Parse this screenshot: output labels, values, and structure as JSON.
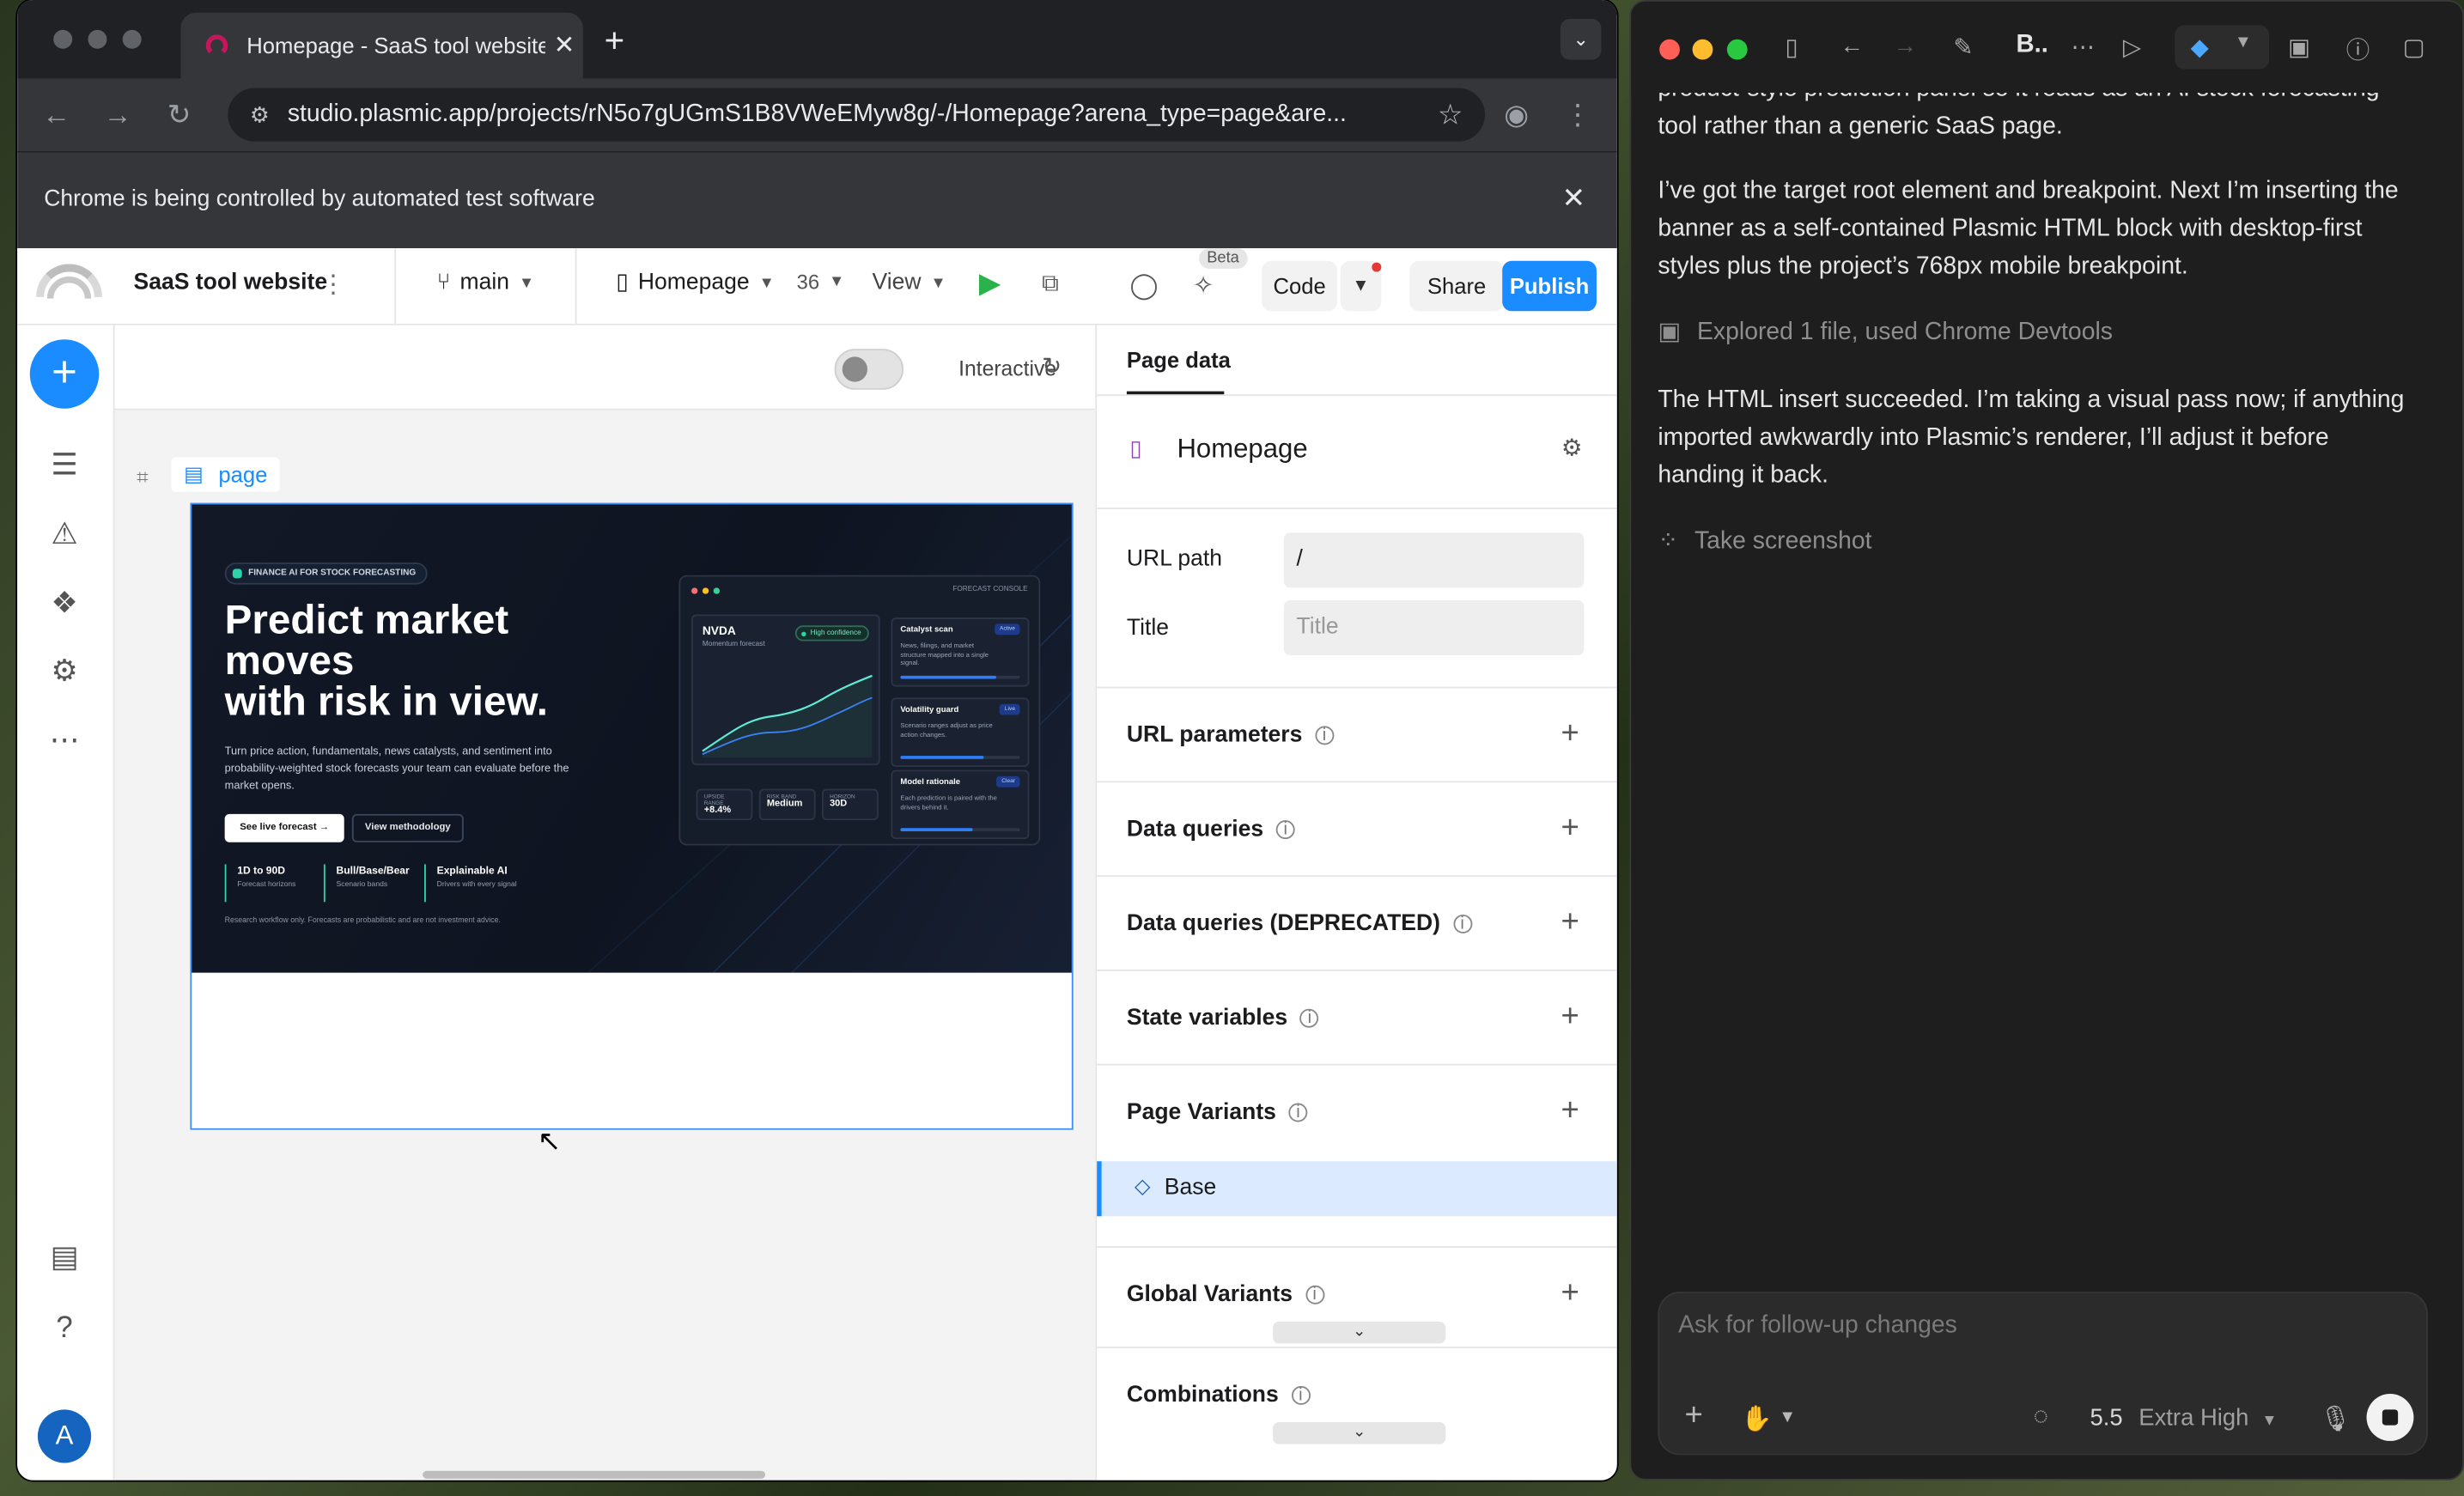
{
  "browser": {
    "tab_title": "Homepage - SaaS tool website",
    "url": "studio.plasmic.app/projects/rN5o7gUGmS1B8VWeEMyw8g/-/Homepage?arena_type=page&are...",
    "automation_notice": "Chrome is being controlled by automated test software"
  },
  "header": {
    "project_name": "SaaS tool website",
    "branch": "main",
    "page_name": "Homepage",
    "version": "36",
    "view_label": "View",
    "beta_badge": "Beta",
    "code_label": "Code",
    "share_label": "Share",
    "publish_label": "Publish"
  },
  "canvas": {
    "interactive_label": "Interactive",
    "page_tag": "page"
  },
  "hero": {
    "badge": "FINANCE AI FOR STOCK FORECASTING",
    "title": "Predict market\nmoves\nwith risk in view.",
    "subtitle": "Turn price action, fundamentals, news catalysts, and sentiment into probability-weighted stock forecasts your team can evaluate before the market opens.",
    "cta_primary": "See live forecast →",
    "cta_secondary": "View methodology",
    "stats": [
      {
        "value": "1D to 90D",
        "label": "Forecast horizons"
      },
      {
        "value": "Bull/Base/Bear",
        "label": "Scenario bands"
      },
      {
        "value": "Explainable AI",
        "label": "Drivers with every signal"
      }
    ],
    "disclaimer": "Research workflow only. Forecasts are probabilistic and are not investment advice.",
    "console": {
      "label": "FORECAST CONSOLE",
      "ticker": "NVDA",
      "ticker_sub": "Momentum forecast",
      "confidence": "High confidence",
      "metrics": [
        {
          "label": "UPSIDE RANGE",
          "value": "+8.4%"
        },
        {
          "label": "RISK BAND",
          "value": "Medium"
        },
        {
          "label": "HORIZON",
          "value": "30D"
        }
      ],
      "cards": [
        {
          "title": "Catalyst scan",
          "pill": "Active",
          "text": "News, filings, and market structure mapped into a single signal.",
          "progress": 0.8
        },
        {
          "title": "Volatility guard",
          "pill": "Live",
          "text": "Scenario ranges adjust as price action changes.",
          "progress": 0.7
        },
        {
          "title": "Model rationale",
          "pill": "Clear",
          "text": "Each prediction is paired with the drivers behind it.",
          "progress": 0.6
        }
      ]
    }
  },
  "panel": {
    "tab": "Page data",
    "page_name": "Homepage",
    "url_path_label": "URL path",
    "url_path_value": "/",
    "title_label": "Title",
    "title_placeholder": "Title",
    "sections": [
      "URL parameters",
      "Data queries",
      "Data queries (DEPRECATED)",
      "State variables",
      "Page Variants",
      "Global Variants",
      "Combinations"
    ],
    "base_variant": "Base"
  },
  "agent": {
    "title": "B..",
    "messages": [
      "product-style prediction panel so it reads as an AI stock forecasting tool rather than a generic SaaS page.",
      "I’ve got the target root element and breakpoint. Next I’m inserting the banner as a self-contained Plasmic HTML block with desktop-first styles plus the project’s 768px mobile breakpoint.",
      "The HTML insert succeeded. I’m taking a visual pass now; if anything imported awkwardly into Plasmic’s renderer, I’ll adjust it before handing it back."
    ],
    "explored_note": "Explored 1 file, used Chrome Devtools",
    "screenshot_action": "Take screenshot",
    "composer_placeholder": "Ask for follow-up changes",
    "model_version": "5.5",
    "model_effort": "Extra High"
  }
}
